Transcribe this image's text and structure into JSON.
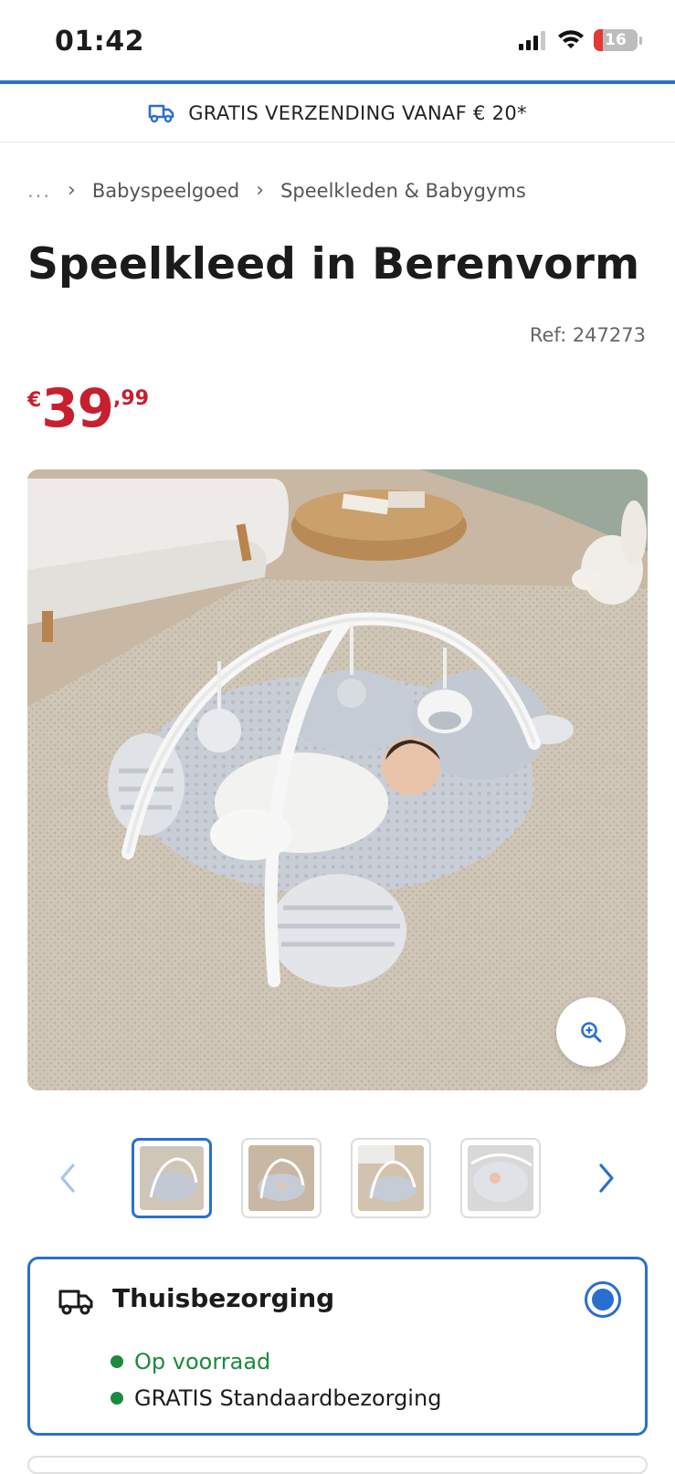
{
  "status_bar": {
    "time": "01:42",
    "battery": "16",
    "icons": [
      "signal-icon",
      "wifi-icon",
      "battery-icon"
    ]
  },
  "promo": {
    "icon": "truck-icon",
    "text": "GRATIS VERZENDING VANAF € 20*"
  },
  "breadcrumb": {
    "ellipsis": "...",
    "items": [
      "Babyspeelgoed",
      "Speelkleden & Babygyms"
    ]
  },
  "product": {
    "title": "Speelkleed in Berenvorm",
    "ref": "Ref: 247273",
    "price": {
      "currency": "€",
      "integer": "39",
      "decimal": ",99"
    }
  },
  "gallery": {
    "image": "baby-playmat-photo",
    "zoom_icon": "zoom-in-icon"
  },
  "thumbnails": {
    "count": 4,
    "active_index": 0,
    "prev_icon": "chevron-left-icon",
    "next_icon": "chevron-right-icon"
  },
  "delivery": {
    "title": "Thuisbezorging",
    "icon": "truck-icon",
    "selected": true,
    "lines": [
      "Op voorraad",
      "GRATIS Standaardbezorging"
    ]
  },
  "colors": {
    "accent": "#2a6fcf",
    "price": "#c6202f",
    "stock": "#1b8a3d"
  }
}
